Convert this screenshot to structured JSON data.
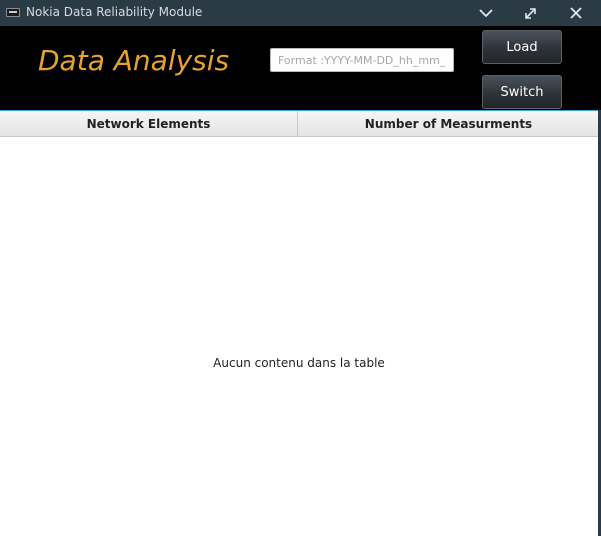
{
  "window": {
    "title": "Nokia Data Reliability Module",
    "controls": [
      "chevron-down-icon",
      "expand-icon",
      "close-icon"
    ]
  },
  "header": {
    "title": "Data Analysis",
    "date_input": {
      "value": "",
      "placeholder": "Format :YYYY-MM-DD_hh_mm_ss"
    },
    "load_label": "Load",
    "switch_label": "Switch"
  },
  "table": {
    "columns": [
      "Network Elements",
      "Number of Measurments"
    ],
    "rows": [],
    "empty_message": "Aucun contenu dans la table"
  },
  "colors": {
    "title_accent": "#e8a22e",
    "titlebar_bg": "#2b3b46",
    "header_bg": "#000000"
  }
}
